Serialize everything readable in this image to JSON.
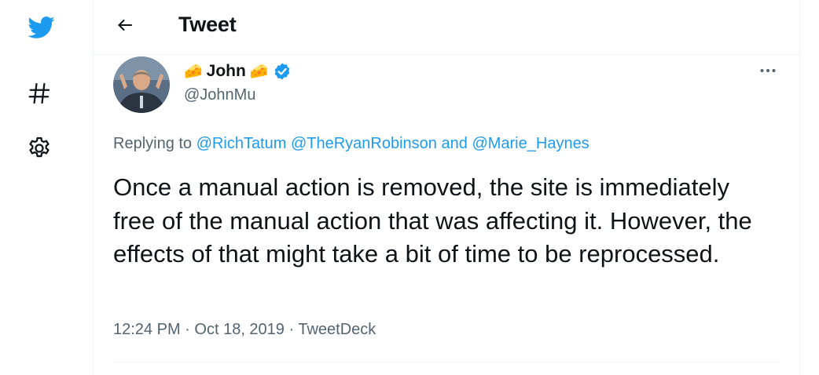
{
  "header": {
    "title": "Tweet"
  },
  "sidebar": {
    "icons": [
      "twitter-bird-icon",
      "hashtag-icon",
      "gear-icon"
    ],
    "accent_color": "#1d9bf0"
  },
  "tweet": {
    "author_name": "John",
    "author_emoji": "🧀",
    "handle": "@JohnMu",
    "verified": true,
    "replying_prefix": "Replying to",
    "mentions": [
      "@RichTatum",
      "@TheRyanRobinson",
      "@Marie_Haynes"
    ],
    "mention_joiner": "and",
    "text": "Once a manual action is removed, the site is immediately free of the manual action that was affecting it. However, the effects of that might take a bit of time to be reprocessed.",
    "time": "12:24 PM",
    "date": "Oct 18, 2019",
    "source": "TweetDeck",
    "separator": "·"
  }
}
